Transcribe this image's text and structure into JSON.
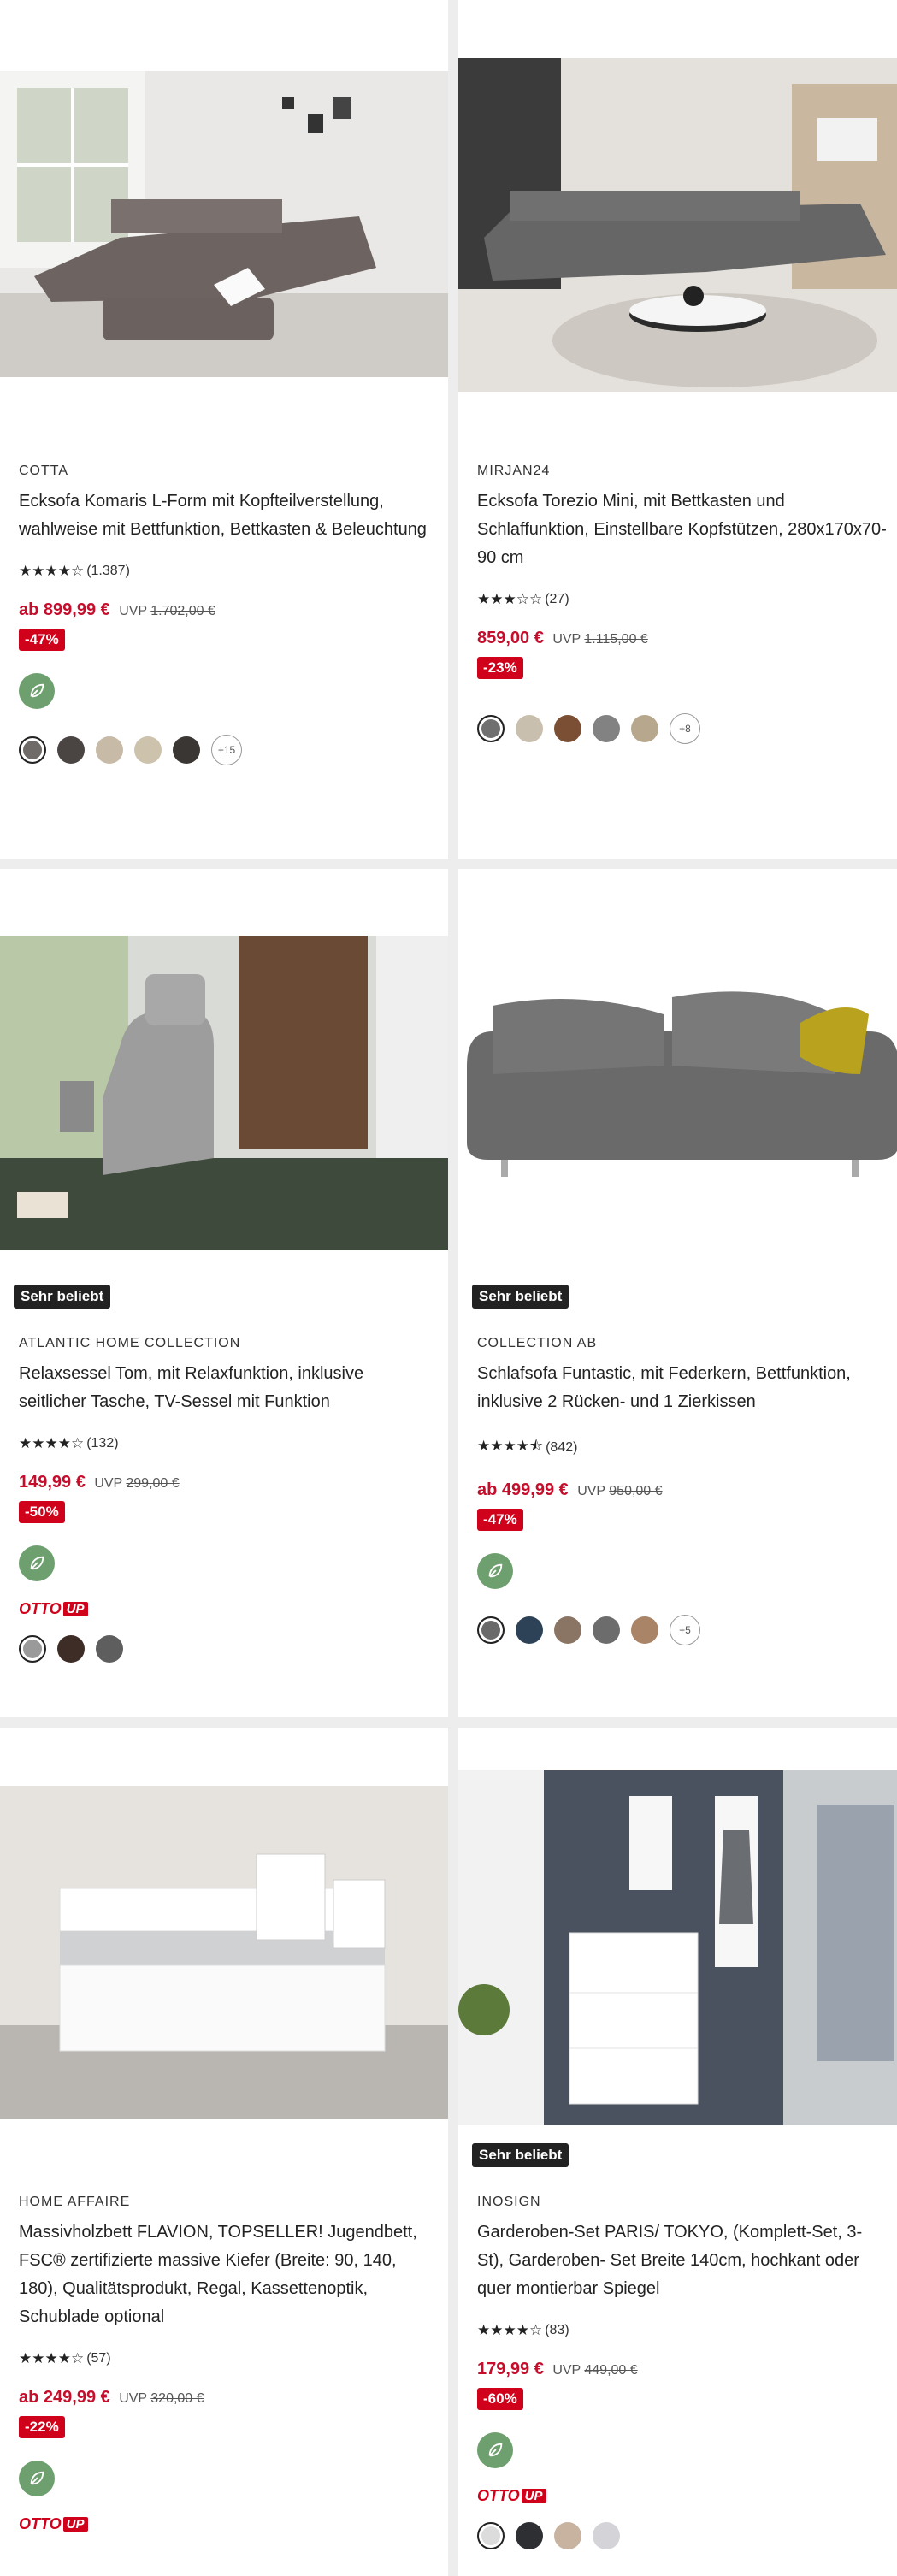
{
  "products": [
    {
      "brand": "COTTA",
      "title": "Ecksofa Komaris L-Form mit Kopfteilverstellung, wahlweise mit Bettfunktion, Bettkasten & Beleuchtung",
      "stars": "★★★★☆",
      "rating_count": "(1.387)",
      "price": "ab 899,99 €",
      "uvp_label": "UVP",
      "old_price": "1.702,00 €",
      "discount": "-47%",
      "more_colors": "+15",
      "colors": [
        "#6f6b68",
        "#4a4543",
        "#c7bba8",
        "#cdc3ad",
        "#3a3634"
      ]
    },
    {
      "brand": "MIRJAN24",
      "title": "Ecksofa Torezio Mini, mit Bettkasten und Schlaffunktion, Einstellbare Kopfstützen, 280x170x70-90 cm",
      "stars": "★★★☆☆",
      "rating_count": "(27)",
      "price": "859,00 €",
      "uvp_label": "UVP",
      "old_price": "1.115,00 €",
      "discount": "-23%",
      "more_colors": "+8",
      "colors": [
        "#707070",
        "#c9bfae",
        "#7a4f33",
        "#828282",
        "#b7a88d"
      ]
    },
    {
      "badge": "Sehr beliebt",
      "brand": "ATLANTIC HOME COLLECTION",
      "title": "Relaxsessel Tom, mit Relaxfunktion, inklusive seitlicher Tasche, TV-Sessel mit Funktion",
      "stars": "★★★★☆",
      "rating_count": "(132)",
      "price": "149,99 €",
      "uvp_label": "UVP",
      "old_price": "299,00 €",
      "discount": "-50%",
      "otto_up": "OTTO",
      "otto_up_tag": "UP",
      "colors": [
        "#9a9a9a",
        "#3e2d26",
        "#5e5e5e"
      ]
    },
    {
      "badge": "Sehr beliebt",
      "brand": "COLLECTION AB",
      "title": "Schlafsofa Funtastic, mit Federkern, Bettfunktion, inklusive 2 Rücken- und 1 Zierkissen",
      "stars": "★★★★⯪",
      "rating_count": "(842)",
      "price": "ab 499,99 €",
      "uvp_label": "UVP",
      "old_price": "950,00 €",
      "discount": "-47%",
      "more_colors": "+5",
      "colors": [
        "#6a6a6a",
        "#2d4257",
        "#8a7564",
        "#6c6c6c",
        "#a98466"
      ]
    },
    {
      "brand": "HOME AFFAIRE",
      "title": "Massivholzbett FLAVION, TOPSELLER! Jugendbett, FSC® zertifizierte massive Kiefer (Breite: 90, 140, 180), Qualitätsprodukt, Regal, Kassettenoptik, Schublade optional",
      "stars": "★★★★☆",
      "rating_count": "(57)",
      "price": "ab 249,99 €",
      "uvp_label": "UVP",
      "old_price": "320,00 €",
      "discount": "-22%",
      "otto_up": "OTTO",
      "otto_up_tag": "UP"
    },
    {
      "badge": "Sehr beliebt",
      "brand": "INOSIGN",
      "title": "Garderoben-Set PARIS/ TOKYO, (Komplett-Set, 3-St), Garderoben- Set Breite 140cm, hochkant oder quer montierbar Spiegel",
      "stars": "★★★★☆",
      "rating_count": "(83)",
      "price": "179,99 €",
      "uvp_label": "UVP",
      "old_price": "449,00 €",
      "discount": "-60%",
      "otto_up": "OTTO",
      "otto_up_tag": "UP",
      "colors": [
        "#dcdcdc",
        "#2e2f33",
        "#c8b3a0",
        "#d4d4d8"
      ]
    }
  ]
}
